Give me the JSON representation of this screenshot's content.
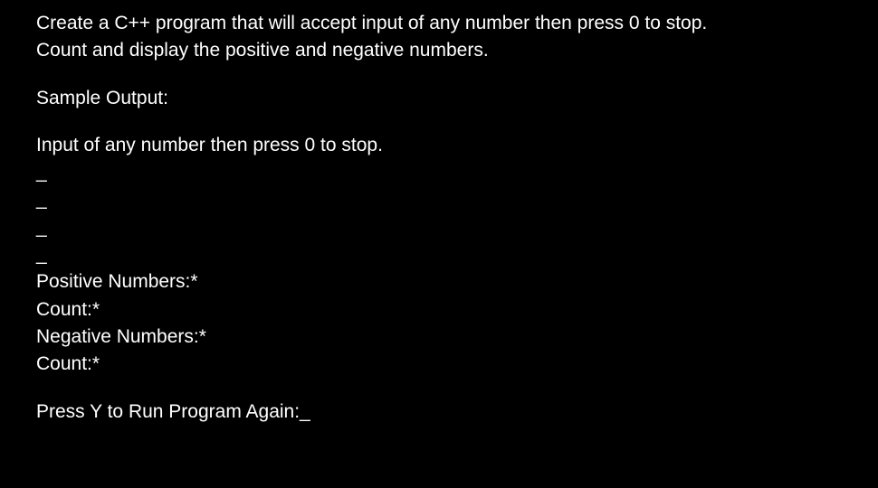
{
  "problem": {
    "line1": "Create a C++ program that will accept input of any number then press 0 to stop.",
    "line2": "Count and display the positive and negative numbers."
  },
  "sample_output_label": "Sample Output:",
  "prompt_input": "Input of any number then press 0 to stop.",
  "input_placeholder_1": "_",
  "input_placeholder_2": "_",
  "input_placeholder_3": "_",
  "input_placeholder_4": "_",
  "positive_label": "Positive Numbers:*",
  "positive_count_label": "Count:*",
  "negative_label": "Negative Numbers:*",
  "negative_count_label": "Count:*",
  "run_again_prompt": "Press Y to Run Program Again:_"
}
